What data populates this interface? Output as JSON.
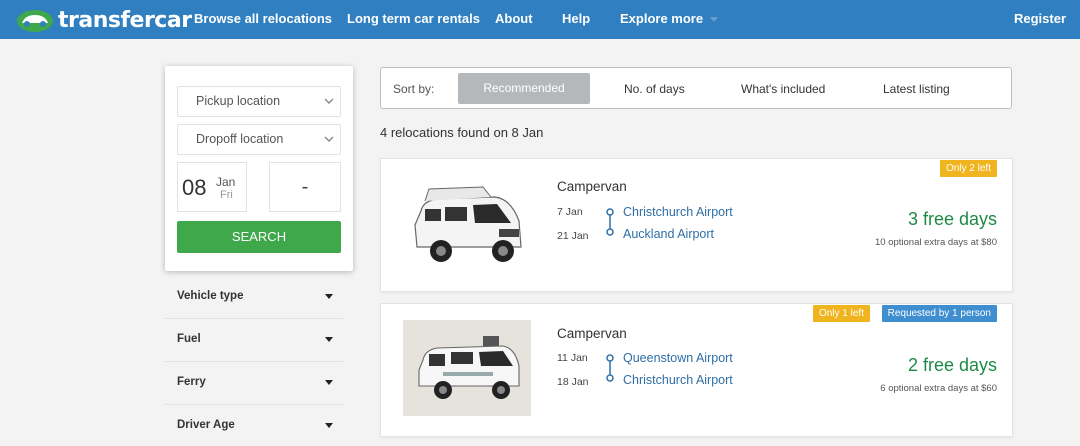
{
  "header": {
    "logo_text": "transfercar",
    "nav": [
      "Browse all relocations",
      "Long term car rentals",
      "About",
      "Help",
      "Explore more"
    ],
    "register": "Register"
  },
  "search": {
    "pickup_placeholder": "Pickup location",
    "dropoff_placeholder": "Dropoff location",
    "date_day": "08",
    "date_month": "Jan",
    "date_weekday": "Fri",
    "end_date": "-",
    "button": "SEARCH"
  },
  "filters": [
    "Vehicle type",
    "Fuel",
    "Ferry",
    "Driver Age"
  ],
  "sort": {
    "label": "Sort by:",
    "options": [
      "Recommended",
      "No. of days",
      "What's included",
      "Latest listing"
    ],
    "active": "Recommended"
  },
  "results_count": "4 relocations found on 8 Jan",
  "results": [
    {
      "vehicle": "Campervan",
      "from_date": "7 Jan",
      "from": "Christchurch Airport",
      "to_date": "21 Jan",
      "to": "Auckland Airport",
      "free_days": "3 free days",
      "extra": "10 optional extra days at $80",
      "badges": [
        "Only 2 left"
      ]
    },
    {
      "vehicle": "Campervan",
      "from_date": "11 Jan",
      "from": "Queenstown Airport",
      "to_date": "18 Jan",
      "to": "Christchurch Airport",
      "free_days": "2 free days",
      "extra": "6 optional extra days at $60",
      "badges": [
        "Only 1 left",
        "Requested by 1 person"
      ]
    }
  ],
  "colors": {
    "header": "#2f7fc1",
    "search_button": "#3ea84a",
    "free_days": "#1f8a45",
    "link": "#2f6fa6",
    "badge_yellow": "#f0b41e",
    "badge_blue": "#3e8ed0"
  }
}
